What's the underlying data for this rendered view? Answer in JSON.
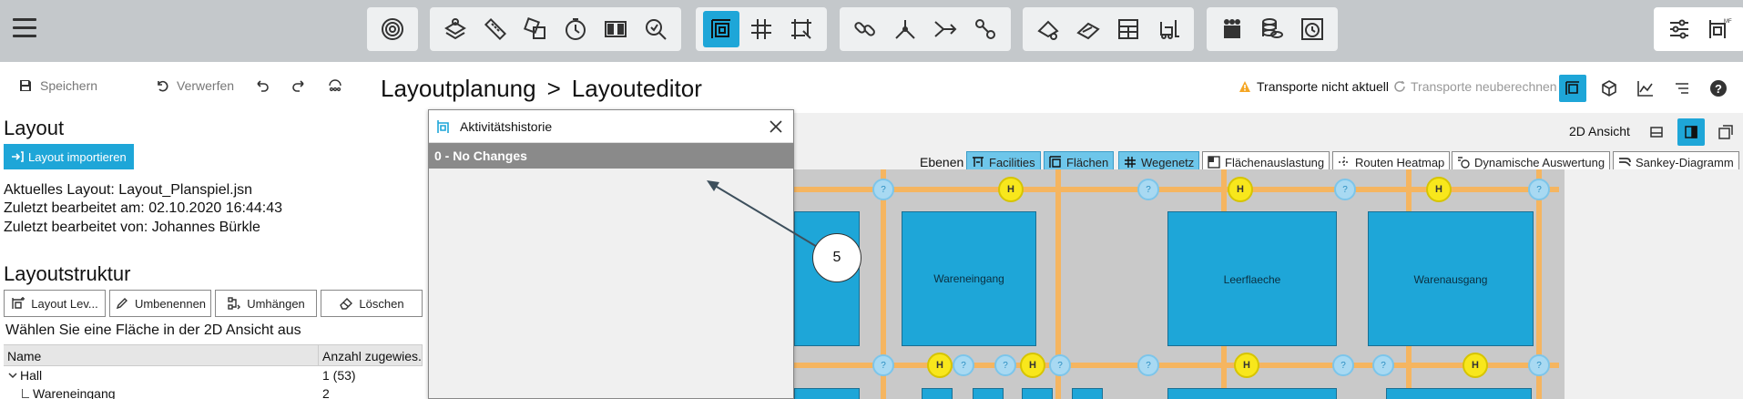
{
  "toolbar": {
    "groups": [
      {
        "icons": [
          "target-icon"
        ],
        "active": []
      },
      {
        "icons": [
          "layers-hand-icon",
          "ruler-icon",
          "shapes-icon",
          "clock-icon",
          "grid-objects-icon",
          "search-zoom-icon"
        ]
      },
      {
        "icons": [
          "facility-icon",
          "grid-icon",
          "area-select-icon"
        ],
        "active": [
          "facility-icon"
        ]
      },
      {
        "icons": [
          "chain-icon",
          "split-icon",
          "merge-icon",
          "link-icon"
        ]
      },
      {
        "icons": [
          "truck-icon",
          "conveyor-icon",
          "rack-icon",
          "forklift-icon"
        ]
      },
      {
        "icons": [
          "people-icon",
          "coins-icon",
          "timer-icon"
        ]
      },
      {
        "icons": [
          "sliders-icon",
          "layout-mf-icon"
        ]
      }
    ]
  },
  "actions": {
    "save": "Speichern",
    "discard": "Verwerfen"
  },
  "page": {
    "breadcrumb_parent": "Layoutplanung",
    "separator": ">",
    "breadcrumb_current": "Layouteditor"
  },
  "status": {
    "warning": "Transporte nicht aktuell",
    "recalc": "Transporte neuberechnen"
  },
  "left": {
    "layout_heading": "Layout",
    "import_button": "Layout importieren",
    "current_layout": "Aktuelles Layout: Layout_Planspiel.jsn",
    "last_edited_at": "Zuletzt bearbeitet am: 02.10.2020 16:44:43",
    "last_edited_by": "Zuletzt bearbeitet von: Johannes Bürkle",
    "structure_heading": "Layoutstruktur",
    "buttons": {
      "layout_level": "Layout Lev...",
      "rename": "Umbenennen",
      "rehang": "Umhängen",
      "delete": "Löschen"
    },
    "hint": "Wählen Sie eine Fläche in der 2D Ansicht aus",
    "table": {
      "col_name": "Name",
      "col_count": "Anzahl zugewies...",
      "rows": [
        {
          "name": "Hall",
          "count": "1 (53)"
        },
        {
          "name": "Wareneingang",
          "count": "2"
        }
      ]
    }
  },
  "view": {
    "label": "2D Ansicht",
    "layers_label": "Ebenen",
    "layers": [
      {
        "label": "Facilities",
        "on": true
      },
      {
        "label": "Flächen",
        "on": true
      },
      {
        "label": "Wegenetz",
        "on": true
      },
      {
        "label": "Flächenauslastung",
        "on": false
      },
      {
        "label": "Routen Heatmap",
        "on": false
      },
      {
        "label": "Dynamische Auswertung",
        "on": false
      },
      {
        "label": "Sankey-Diagramm",
        "on": false
      }
    ]
  },
  "canvas": {
    "areas": [
      "Wareneingang",
      "Leerflaeche",
      "Warenausgang"
    ],
    "node_glyph": "?",
    "hub_glyph": "H"
  },
  "dialog": {
    "title": "Aktivitätshistorie",
    "row": "0 - No Changes"
  },
  "annotation": "5",
  "colors": {
    "accent": "#1ea6d8",
    "toolbar_bg": "#c4c8cb",
    "path": "#f5b560",
    "hub": "#f8e71c",
    "warning": "#f5a623"
  }
}
